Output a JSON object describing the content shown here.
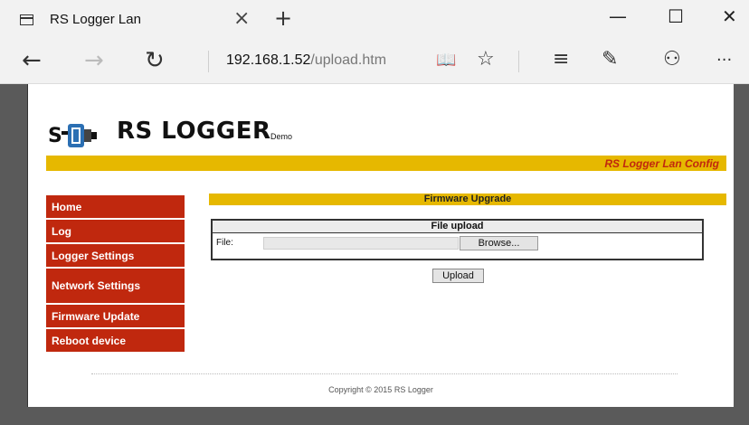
{
  "tab": {
    "title": "RS Logger Lan",
    "close": "×",
    "new_tab": "+"
  },
  "window": {
    "minimize": "—",
    "maximize": "☐",
    "close": "✕"
  },
  "toolbar": {
    "back": "←",
    "forward": "→",
    "refresh": "↻",
    "url_host": "192.168.1.52",
    "url_path": "/upload.htm",
    "reading_view": "📖",
    "favorite": "☆",
    "hub": "≡",
    "notes": "✎",
    "share": "⚇",
    "more": "···"
  },
  "page": {
    "brand": "RS LOGGER",
    "brand_sub": "Demo",
    "config_title": "RS Logger Lan Config",
    "nav": [
      {
        "label": "Home"
      },
      {
        "label": "Log"
      },
      {
        "label": "Logger Settings"
      },
      {
        "label": "Network Settings"
      },
      {
        "label": "Firmware Update"
      },
      {
        "label": "Reboot device"
      }
    ],
    "section_title": "Firmware Upgrade",
    "upload_head": "File upload",
    "file_label": "File:",
    "browse_label": "Browse...",
    "upload_label": "Upload",
    "copyright": "Copyright © 2015 RS Logger"
  },
  "colors": {
    "accent_yellow": "#e6b800",
    "nav_red": "#c0280e",
    "config_red": "#c0280e"
  }
}
